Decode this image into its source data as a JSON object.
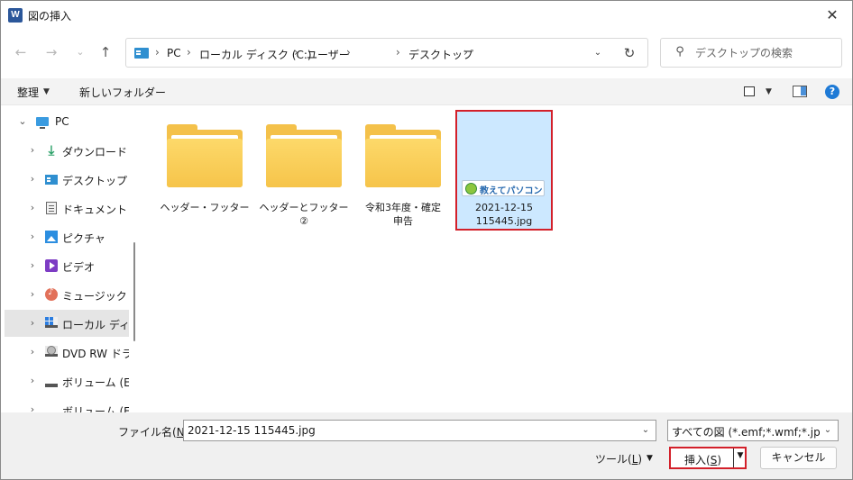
{
  "window": {
    "app_icon_letter": "W",
    "title": "図の挿入",
    "close_glyph": "✕"
  },
  "nav_buttons": {
    "back": "←",
    "forward": "→",
    "recent": "⌄",
    "up": "↑"
  },
  "address": {
    "crumbs": [
      "PC",
      "ローカル ディスク (C:)",
      "ユーザー",
      "",
      "デスクトップ"
    ],
    "separator": "›",
    "dropdown_glyph": "⌄",
    "refresh_glyph": "↻"
  },
  "search": {
    "placeholder": "デスクトップの検索",
    "icon_glyph": "⚲"
  },
  "commandbar": {
    "organize": "整理",
    "organize_caret": "▼",
    "new_folder": "新しいフォルダー",
    "view_caret": "▼",
    "help": "?"
  },
  "navpane": {
    "chevron_expanded": "⌄",
    "chevron_collapsed": "›",
    "items": [
      {
        "label": "PC",
        "icon": "pc-icon",
        "expanded": true
      },
      {
        "label": "ダウンロード",
        "icon": "download-icon"
      },
      {
        "label": "デスクトップ",
        "icon": "desktop-icon"
      },
      {
        "label": "ドキュメント",
        "icon": "documents-icon"
      },
      {
        "label": "ピクチャ",
        "icon": "pictures-icon"
      },
      {
        "label": "ビデオ",
        "icon": "videos-icon"
      },
      {
        "label": "ミュージック",
        "icon": "music-icon"
      },
      {
        "label": "ローカル ディスク",
        "icon": "drive-icon",
        "selected": true
      },
      {
        "label": "DVD RW ドライ",
        "icon": "dvd-icon"
      },
      {
        "label": "ボリューム (E:)",
        "icon": "volume-icon"
      },
      {
        "label": "ボリューム (F:)",
        "icon": "volume-icon"
      }
    ]
  },
  "files": [
    {
      "type": "folder",
      "label": "ヘッダー・フッター"
    },
    {
      "type": "folder",
      "label": "ヘッダーとフッター②"
    },
    {
      "type": "folder",
      "label_line1": "令和3年度・確定",
      "label_line2": "申告"
    },
    {
      "type": "image",
      "label_line1": "2021-12-15",
      "label_line2": "115445.jpg",
      "thumb_text": "教えてパソコン",
      "selected": true
    }
  ],
  "bottom": {
    "filename_label_prefix": "ファイル名(",
    "filename_label_key": "N",
    "filename_label_suffix": "):",
    "filename_value": "2021-12-15 115445.jpg",
    "filter_value": "すべての図 (*.emf;*.wmf;*.jpg;*.jpeg;*.jfif;*.jpe;*.png;*.bmp)",
    "dropdown_glyph": "⌄",
    "tools_prefix": "ツール(",
    "tools_key": "L",
    "tools_suffix": ")",
    "tools_caret": "▼",
    "insert_prefix": "挿入(",
    "insert_key": "S",
    "insert_suffix": ")",
    "insert_caret": "▼",
    "cancel": "キャンセル"
  },
  "colors": {
    "accent_red": "#d3202a",
    "selection_blue": "#cce8ff",
    "folder_yellow": "#f4c14a"
  }
}
